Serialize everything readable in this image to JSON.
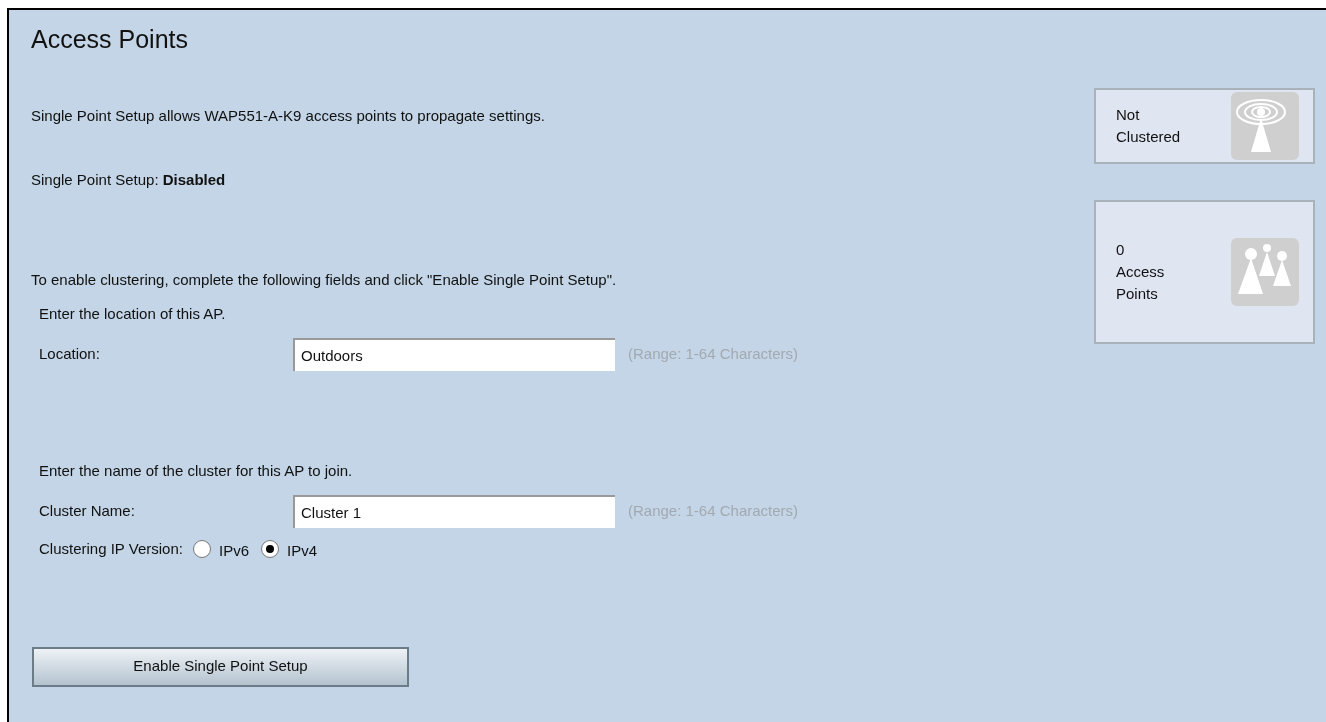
{
  "title": "Access Points",
  "intro": "Single Point Setup allows WAP551-A-K9 access points to propagate settings.",
  "status_line": "Single Point Setup: **Disabled**",
  "instructions": "To enable clustering, complete the following fields and click \"Enable Single Point Setup\".",
  "sections": [
    {
      "heading": "Enter the location of this AP.",
      "label": "Location:",
      "value": "Outdoors",
      "hint": "(Range: 1-64 Characters)"
    },
    {
      "heading": "Enter the name of the cluster for this AP to join.",
      "label": "Cluster Name:",
      "value": "Cluster 1",
      "hint": "(Range: 1-64 Characters)"
    }
  ],
  "ip_version": {
    "label": "Clustering IP Version:",
    "options": [
      {
        "label": "IPv6",
        "selected": false
      },
      {
        "label": "IPv4",
        "selected": true
      }
    ]
  },
  "button": "Enable Single Point Setup",
  "cards": [
    {
      "kind": "cluster",
      "lines": [
        "Not",
        "Clustered"
      ]
    },
    {
      "kind": "aps",
      "lines": [
        "0",
        "Access",
        "Points"
      ]
    }
  ]
}
